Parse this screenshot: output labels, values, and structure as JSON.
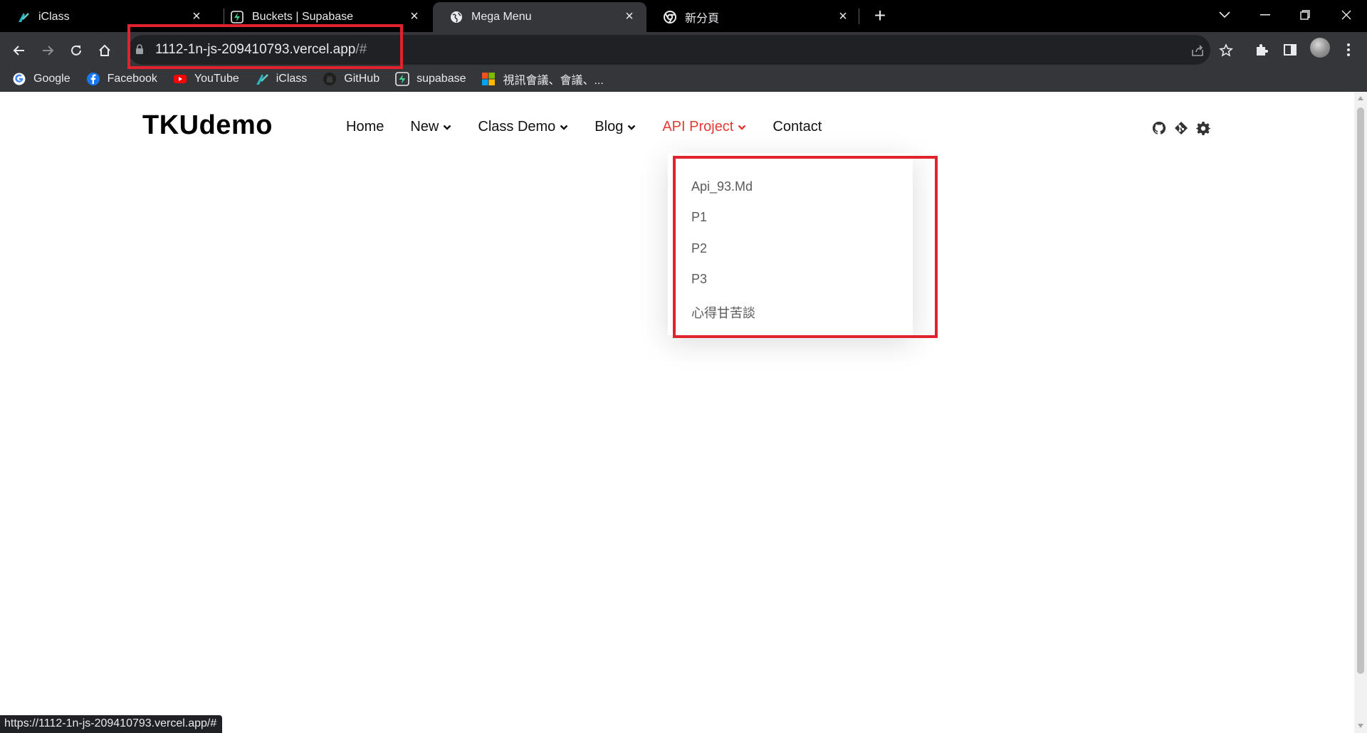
{
  "browser": {
    "tabs": [
      {
        "title": "iClass",
        "icon": "iclass-icon",
        "active": false
      },
      {
        "title": "Buckets | Supabase",
        "icon": "supabase-icon",
        "active": false
      },
      {
        "title": "Mega Menu",
        "icon": "globe-icon",
        "active": true
      },
      {
        "title": "新分頁",
        "icon": "chrome-icon",
        "active": false
      }
    ],
    "address_bar": {
      "url_main": "1112-1n-js-209410793.vercel.app",
      "url_suffix": "/#"
    },
    "bookmarks": [
      {
        "label": "Google",
        "icon": "google-icon"
      },
      {
        "label": "Facebook",
        "icon": "facebook-icon"
      },
      {
        "label": "YouTube",
        "icon": "youtube-icon"
      },
      {
        "label": "iClass",
        "icon": "iclass-icon"
      },
      {
        "label": "GitHub",
        "icon": "github-icon"
      },
      {
        "label": "supabase",
        "icon": "supabase-icon"
      },
      {
        "label": "視訊會議、會議、...",
        "icon": "microsoft-icon"
      }
    ],
    "status_url": "https://1112-1n-js-209410793.vercel.app/#"
  },
  "site": {
    "logo": "TKUdemo",
    "nav": [
      {
        "label": "Home",
        "has_dropdown": false
      },
      {
        "label": "New",
        "has_dropdown": true
      },
      {
        "label": "Class Demo",
        "has_dropdown": true
      },
      {
        "label": "Blog",
        "has_dropdown": true
      },
      {
        "label": "API Project",
        "has_dropdown": true,
        "active": true
      },
      {
        "label": "Contact",
        "has_dropdown": false
      }
    ],
    "header_icons": [
      "github-icon",
      "git-icon",
      "gear-icon"
    ],
    "dropdown_items": [
      "Api_93.Md",
      "P1",
      "P2",
      "P3",
      "心得甘苦談"
    ]
  },
  "colors": {
    "accent": "#e53935",
    "highlight_box": "#e0232f",
    "chrome_dark": "#35363a"
  }
}
